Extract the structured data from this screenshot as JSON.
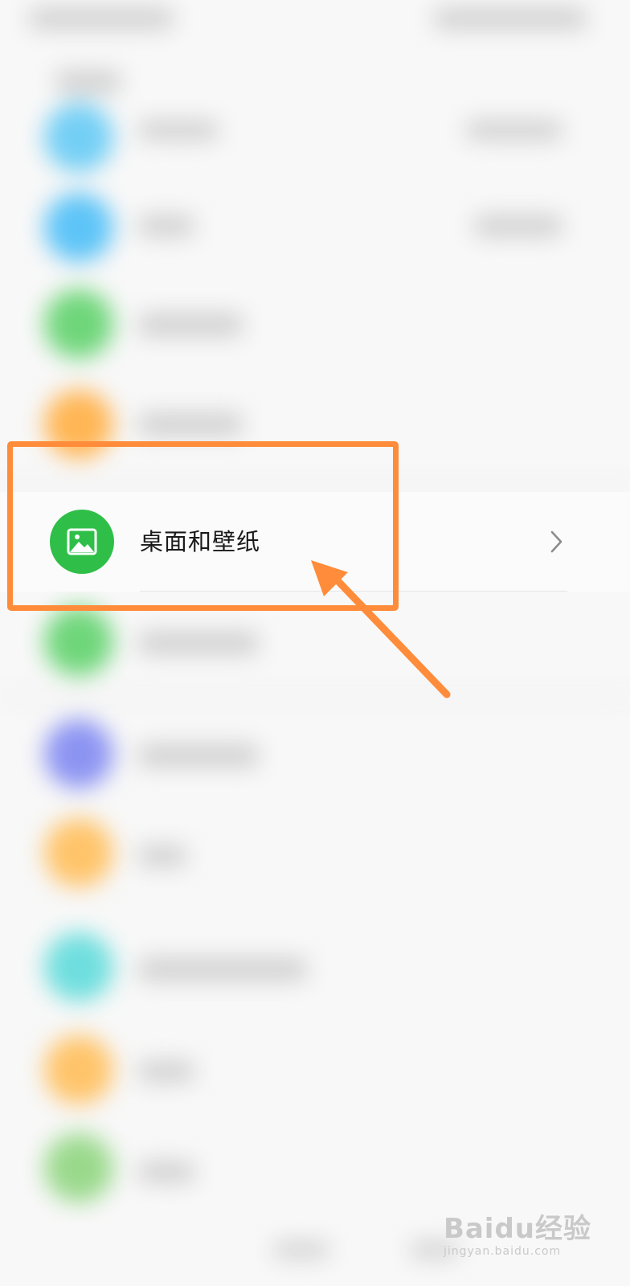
{
  "focused_item": {
    "label": "桌面和壁纸",
    "icon": "picture-icon",
    "icon_color": "#2fbf48",
    "trailing_icon": "chevron-right-icon"
  },
  "annotation": {
    "color": "#ff8c3a"
  },
  "watermark": {
    "brand": "Baidu经验",
    "url": "jingyan.baidu.com"
  },
  "blurred_icon_colors": [
    "#74cff5",
    "#5ec4f7",
    "#6fd67a",
    "#ffb655",
    "#6fd67a",
    "#8c94f2",
    "#ffc46a",
    "#6fdede",
    "#ffc46a",
    "#9ad98c"
  ]
}
